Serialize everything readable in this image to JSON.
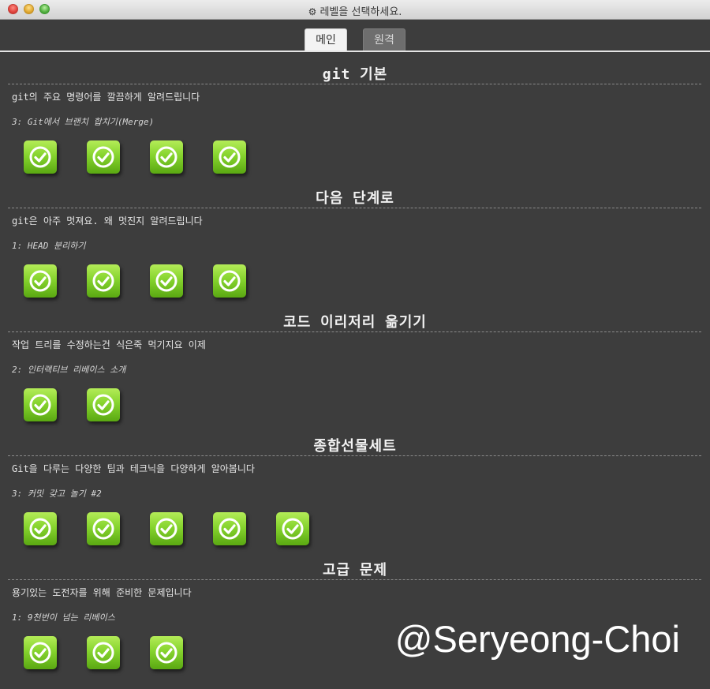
{
  "window": {
    "title": "레벨을 선택하세요.",
    "title_icon": "gear-icon"
  },
  "tabs": [
    {
      "label": "메인",
      "active": true
    },
    {
      "label": "원격",
      "active": false
    }
  ],
  "sections": [
    {
      "title": "git 기본",
      "description": "git의 주요 명령어를 깔끔하게 알려드립니다",
      "last_level": "3: Git에서 브랜치 합치기(Merge)",
      "levels": [
        "completed",
        "completed",
        "completed",
        "completed"
      ]
    },
    {
      "title": "다음 단계로",
      "description": "git은 아주 멋져요. 왜 멋진지 알려드립니다",
      "last_level": "1: HEAD 분리하기",
      "levels": [
        "completed",
        "completed",
        "completed",
        "completed"
      ]
    },
    {
      "title": "코드 이리저리 옮기기",
      "description": "작업 트리를 수정하는건 식은죽 먹기지요 이제",
      "last_level": "2: 인터랙티브 리베이스 소개",
      "levels": [
        "completed",
        "completed"
      ]
    },
    {
      "title": "종합선물세트",
      "description": "Git을 다루는 다양한 팁과 테크닉을 다양하게 알아봅니다",
      "last_level": "3: 커밋 갖고 놀기 #2",
      "levels": [
        "completed",
        "completed",
        "completed",
        "completed",
        "completed"
      ]
    },
    {
      "title": "고급 문제",
      "description": "용기있는 도전자를 위해 준비한 문제입니다",
      "last_level": "1: 9천번이 넘는 리베이스",
      "levels": [
        "completed",
        "completed",
        "completed"
      ]
    }
  ],
  "watermark": "@Seryeong-Choi",
  "colors": {
    "background": "#3d3d3d",
    "level_complete": "#86d42e"
  }
}
